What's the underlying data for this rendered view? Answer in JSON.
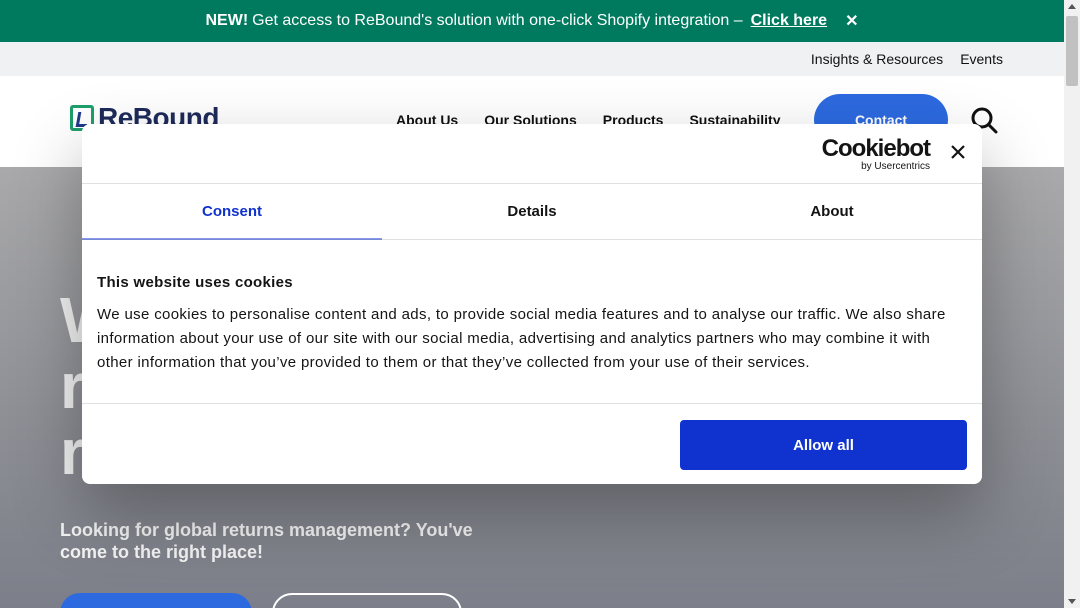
{
  "announcement": {
    "new_label": "NEW!",
    "message": "Get access to ReBound's solution with one-click Shopify integration –",
    "link_label": "Click here",
    "close_glyph": "✕"
  },
  "utility_nav": [
    "Insights & Resources",
    "Events"
  ],
  "header": {
    "logo_text": "ReBound",
    "nav": [
      "About Us",
      "Our Solutions",
      "Products",
      "Sustainability"
    ],
    "contact_label": "Contact"
  },
  "hero": {
    "title_lines": [
      "W",
      "r",
      "r"
    ],
    "subtitle": "Looking for global returns management? You've come to the right place!"
  },
  "cookie_dialog": {
    "brand_name": "Cookiebot",
    "brand_by": "by Usercentrics",
    "tabs": [
      {
        "label": "Consent",
        "active": true
      },
      {
        "label": "Details",
        "active": false
      },
      {
        "label": "About",
        "active": false
      }
    ],
    "heading": "This website uses cookies",
    "body": "We use cookies to personalise content and ads, to provide social media features and to analyse our traffic. We also share information about your use of our site with our social media, advertising and analytics partners who may combine it with other information that you’ve provided to them or that they’ve collected from your use of their services.",
    "allow_all_label": "Allow all"
  },
  "colors": {
    "announcement_bg": "#007a5e",
    "brand_blue": "#2d6ae0",
    "cookiebot_blue": "#1032cf"
  },
  "icons": {
    "search": "search-icon",
    "close": "close-icon"
  }
}
